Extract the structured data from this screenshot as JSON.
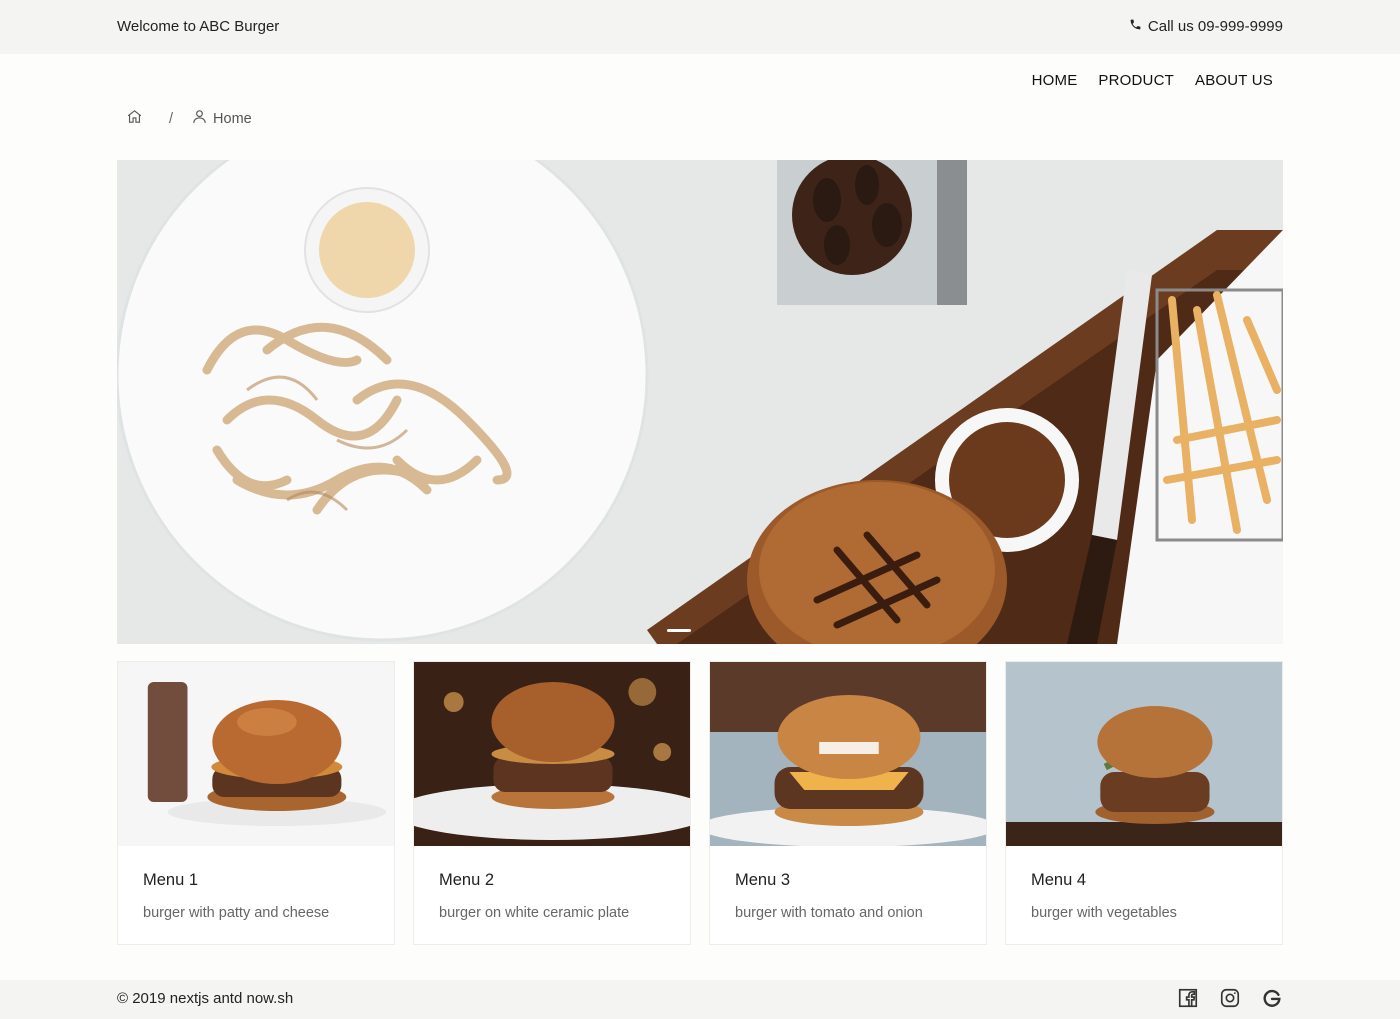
{
  "topbar": {
    "welcome": "Welcome to ABC Burger",
    "phone_icon": "phone-icon",
    "call": "Call us 09-999-9999"
  },
  "nav": {
    "items": [
      {
        "label": "HOME"
      },
      {
        "label": "PRODUCT"
      },
      {
        "label": "ABOUT US"
      }
    ]
  },
  "breadcrumb": {
    "home_icon": "home-icon",
    "separator": "/",
    "user_icon": "user-icon",
    "current": "Home"
  },
  "hero": {
    "carousel_active_index": 0
  },
  "cards": [
    {
      "title": "Menu 1",
      "description": "burger with patty and cheese"
    },
    {
      "title": "Menu 2",
      "description": "burger on white ceramic plate"
    },
    {
      "title": "Menu 3",
      "description": "burger with tomato and onion"
    },
    {
      "title": "Menu 4",
      "description": "burger with vegetables"
    }
  ],
  "footer": {
    "copyright": "© 2019 nextjs antd now.sh",
    "social": [
      "facebook-icon",
      "instagram-icon",
      "google-icon"
    ]
  },
  "colors": {
    "background": "#fdfdfb",
    "bar_background": "#f4f4f2",
    "text": "#222222",
    "muted_text": "#666666"
  }
}
